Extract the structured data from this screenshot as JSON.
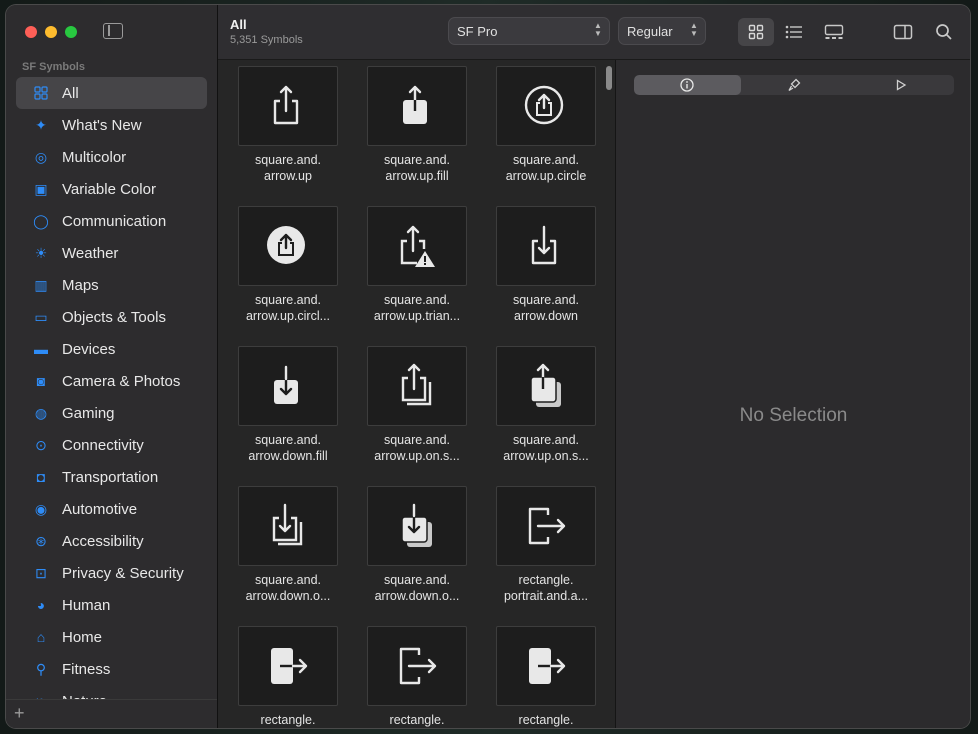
{
  "sidebar": {
    "section_label": "SF Symbols",
    "items": [
      {
        "label": "All",
        "icon": "grid-icon",
        "selected": true
      },
      {
        "label": "What's New",
        "icon": "sparkle-icon"
      },
      {
        "label": "Multicolor",
        "icon": "palette-icon"
      },
      {
        "label": "Variable Color",
        "icon": "variable-color-icon"
      },
      {
        "label": "Communication",
        "icon": "message-bubble-icon"
      },
      {
        "label": "Weather",
        "icon": "sun-cloud-icon"
      },
      {
        "label": "Maps",
        "icon": "map-icon"
      },
      {
        "label": "Objects & Tools",
        "icon": "folder-icon"
      },
      {
        "label": "Devices",
        "icon": "display-icon"
      },
      {
        "label": "Camera & Photos",
        "icon": "camera-icon"
      },
      {
        "label": "Gaming",
        "icon": "gamecontroller-icon"
      },
      {
        "label": "Connectivity",
        "icon": "antenna-icon"
      },
      {
        "label": "Transportation",
        "icon": "car-icon"
      },
      {
        "label": "Automotive",
        "icon": "steering-wheel-icon"
      },
      {
        "label": "Accessibility",
        "icon": "accessibility-icon"
      },
      {
        "label": "Privacy & Security",
        "icon": "lock-icon"
      },
      {
        "label": "Human",
        "icon": "person-circle-icon"
      },
      {
        "label": "Home",
        "icon": "house-icon"
      },
      {
        "label": "Fitness",
        "icon": "figure-run-icon"
      },
      {
        "label": "Nature",
        "icon": "leaf-icon"
      }
    ]
  },
  "toolbar": {
    "title": "All",
    "subtitle": "5,351 Symbols",
    "font_popup": "SF Pro",
    "weight_popup": "Regular"
  },
  "symbols": [
    {
      "name": "square.and.\narrow.up",
      "icon": "share-icon"
    },
    {
      "name": "square.and.\narrow.up.fill",
      "icon": "share-fill-icon"
    },
    {
      "name": "square.and.\narrow.up.circle",
      "icon": "share-circle-icon"
    },
    {
      "name": "square.and.\narrow.up.circl...",
      "icon": "share-circle-fill-icon"
    },
    {
      "name": "square.and.\narrow.up.trian...",
      "icon": "share-triangle-icon"
    },
    {
      "name": "square.and.\narrow.down",
      "icon": "download-icon"
    },
    {
      "name": "square.and.\narrow.down.fill",
      "icon": "download-fill-icon"
    },
    {
      "name": "square.and.\narrow.up.on.s...",
      "icon": "share-stack-icon"
    },
    {
      "name": "square.and.\narrow.up.on.s...",
      "icon": "share-stack-fill-icon"
    },
    {
      "name": "square.and.\narrow.down.o...",
      "icon": "download-stack-icon"
    },
    {
      "name": "square.and.\narrow.down.o...",
      "icon": "download-stack-fill-icon"
    },
    {
      "name": "rectangle.\nportrait.and.a...",
      "icon": "rect-arrow-right-icon"
    },
    {
      "name": "rectangle.",
      "icon": "rect-arrow-right-fill-icon"
    },
    {
      "name": "rectangle.",
      "icon": "rect-arrow-right-icon"
    },
    {
      "name": "rectangle.",
      "icon": "rect-arrow-right-fill-icon"
    }
  ],
  "inspector": {
    "placeholder": "No Selection"
  },
  "colors": {
    "accent": "#2e8cf7",
    "window_bg": "#262626",
    "sidebar_bg": "#2d2c2e"
  }
}
